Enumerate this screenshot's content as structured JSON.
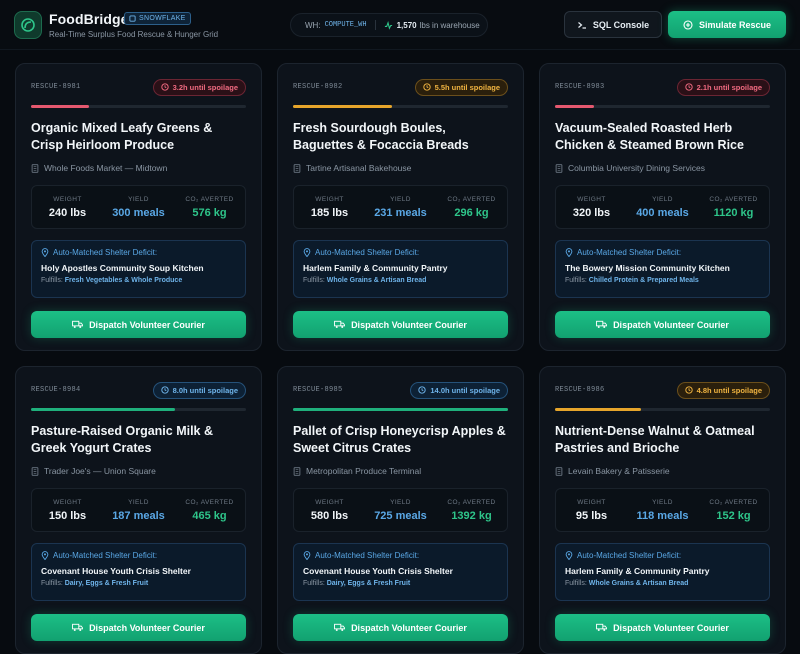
{
  "header": {
    "brand_name": "FoodBridge",
    "brand_badge": "SNOWFLAKE",
    "subtitle": "Real-Time Surplus Food Rescue & Hunger Grid",
    "warehouse_label": "WH:",
    "warehouse_code": "COMPUTE_WH",
    "warehouse_count": "1,570",
    "warehouse_suffix": "lbs in warehouse",
    "sql_button": "SQL Console",
    "simulate_button": "Simulate Rescue"
  },
  "labels": {
    "weight": "WEIGHT",
    "yield": "YIELD",
    "co2": "CO₂ AVERTED",
    "match_head": "Auto-Matched Shelter Deficit:",
    "fulfills": "Fulfills:",
    "dispatch": "Dispatch Volunteer Courier"
  },
  "colors": {
    "red": "#e5586f",
    "amber": "#e6a52b",
    "blue": "#5aa8e6",
    "green": "#1fb07c",
    "weight_text": "#f2f6f9",
    "yield_text": "#5aa8e6",
    "co2_text": "#2ec58a"
  },
  "cards": [
    {
      "id": "RESCUE-8981",
      "spoilage": "3.2h until spoilage",
      "urgency": "red",
      "progress": 0.27,
      "title": "Organic Mixed Leafy Greens & Crisp Heirloom Produce",
      "vendor": "Whole Foods Market — Midtown",
      "weight": "240 lbs",
      "yield": "300 meals",
      "co2": "576 kg",
      "shelter": "Holy Apostles Community Soup Kitchen",
      "fulfills": "Fresh Vegetables & Whole Produce"
    },
    {
      "id": "RESCUE-8982",
      "spoilage": "5.5h until spoilage",
      "urgency": "amber",
      "progress": 0.46,
      "title": "Fresh Sourdough Boules, Baguettes & Focaccia Breads",
      "vendor": "Tartine Artisanal Bakehouse",
      "weight": "185 lbs",
      "yield": "231 meals",
      "co2": "296 kg",
      "shelter": "Harlem Family & Community Pantry",
      "fulfills": "Whole Grains & Artisan Bread"
    },
    {
      "id": "RESCUE-8983",
      "spoilage": "2.1h until spoilage",
      "urgency": "red",
      "progress": 0.18,
      "title": "Vacuum-Sealed Roasted Herb Chicken & Steamed Brown Rice",
      "vendor": "Columbia University Dining Services",
      "weight": "320 lbs",
      "yield": "400 meals",
      "co2": "1120 kg",
      "shelter": "The Bowery Mission Community Kitchen",
      "fulfills": "Chilled Protein & Prepared Meals"
    },
    {
      "id": "RESCUE-8984",
      "spoilage": "8.0h until spoilage",
      "urgency": "blue",
      "progress": 0.67,
      "title": "Pasture-Raised Organic Milk & Greek Yogurt Crates",
      "vendor": "Trader Joe's — Union Square",
      "weight": "150 lbs",
      "yield": "187 meals",
      "co2": "465 kg",
      "shelter": "Covenant House Youth Crisis Shelter",
      "fulfills": "Dairy, Eggs & Fresh Fruit"
    },
    {
      "id": "RESCUE-8985",
      "spoilage": "14.0h until spoilage",
      "urgency": "blue",
      "progress": 1.0,
      "title": "Pallet of Crisp Honeycrisp Apples & Sweet Citrus Crates",
      "vendor": "Metropolitan Produce Terminal",
      "weight": "580 lbs",
      "yield": "725 meals",
      "co2": "1392 kg",
      "shelter": "Covenant House Youth Crisis Shelter",
      "fulfills": "Dairy, Eggs & Fresh Fruit"
    },
    {
      "id": "RESCUE-8986",
      "spoilage": "4.8h until spoilage",
      "urgency": "amber",
      "progress": 0.4,
      "title": "Nutrient-Dense Walnut & Oatmeal Pastries and Brioche",
      "vendor": "Levain Bakery & Patisserie",
      "weight": "95 lbs",
      "yield": "118 meals",
      "co2": "152 kg",
      "shelter": "Harlem Family & Community Pantry",
      "fulfills": "Whole Grains & Artisan Bread"
    }
  ]
}
